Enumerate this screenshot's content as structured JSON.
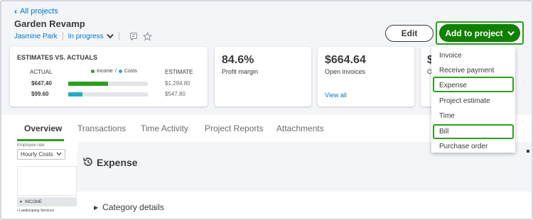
{
  "nav": {
    "back_label": "All projects"
  },
  "project": {
    "title": "Garden Revamp",
    "customer": "Jasmine Park",
    "status": "In progress"
  },
  "actions": {
    "edit_label": "Edit",
    "add_label": "Add to project"
  },
  "estimates": {
    "title": "ESTIMATES VS. ACTUALS",
    "actual_header": "ACTUAL",
    "estimate_header": "ESTIMATE",
    "legend_income": "Income",
    "legend_sep": "/",
    "legend_costs": "Costs",
    "colors": {
      "income": "#2ca01c",
      "costs": "#21abc4"
    },
    "rows": [
      {
        "actual": "$647.40",
        "estimate": "$1,294.80",
        "fill_fraction": 0.5,
        "type": "income"
      },
      {
        "actual": "$99.60",
        "estimate": "$547.80",
        "fill_fraction": 0.18,
        "type": "costs"
      }
    ]
  },
  "stats": {
    "profit_margin_value": "84.6%",
    "profit_margin_label": "Profit margin",
    "open_invoices_value": "$664.64",
    "open_invoices_label": "Open invoices",
    "open_invoices_link": "View all",
    "fourth_value": "$",
    "fourth_label": "O"
  },
  "tabs": [
    {
      "label": "Overview",
      "active": true
    },
    {
      "label": "Transactions",
      "active": false
    },
    {
      "label": "Time Activity",
      "active": false
    },
    {
      "label": "Project Reports",
      "active": false
    },
    {
      "label": "Attachments",
      "active": false
    }
  ],
  "filters": {
    "rate_label": "Employee rate",
    "rate_value": "Hourly Costs",
    "income_group": "INCOME",
    "service_row": "Landscaping Services"
  },
  "expense": {
    "title": "Expense",
    "category_label": "Category details"
  },
  "menu": {
    "items": [
      "Invoice",
      "Receive payment",
      "Expense",
      "Project estimate",
      "Time",
      "Bill",
      "Purchase order"
    ],
    "highlighted": [
      "Expense",
      "Bill"
    ]
  }
}
